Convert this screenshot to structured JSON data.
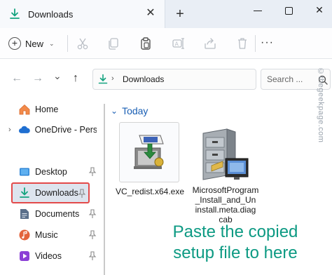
{
  "window": {
    "tab_title": "Downloads",
    "close_tab_glyph": "✕",
    "new_tab_glyph": "+",
    "minimize_label": "",
    "maximize_label": "",
    "close_glyph": "✕"
  },
  "toolbar": {
    "new_label": "New",
    "new_caret": "⌄",
    "more_glyph": "···",
    "icons": [
      "cut-icon",
      "copy-icon",
      "paste-icon",
      "rename-icon",
      "share-icon",
      "delete-icon"
    ]
  },
  "address": {
    "back_glyph": "←",
    "forward_glyph": "→",
    "dropdown_glyph": "⌄",
    "up_glyph": "↑",
    "path_chevron": "›",
    "path_label": "Downloads",
    "search_placeholder": "Search ..."
  },
  "sidebar": {
    "items": [
      {
        "label": "Home",
        "icon": "home-icon",
        "chevron": "",
        "pinned": false
      },
      {
        "label": "OneDrive - Pers",
        "icon": "cloud-icon",
        "chevron": "›",
        "pinned": false
      },
      {
        "label": "Desktop",
        "icon": "desktop-icon",
        "chevron": "",
        "pinned": true
      },
      {
        "label": "Downloads",
        "icon": "download-icon",
        "chevron": "",
        "pinned": true,
        "selected": true
      },
      {
        "label": "Documents",
        "icon": "document-icon",
        "chevron": "",
        "pinned": true
      },
      {
        "label": "Music",
        "icon": "music-icon",
        "chevron": "",
        "pinned": true
      },
      {
        "label": "Videos",
        "icon": "video-icon",
        "chevron": "",
        "pinned": true
      }
    ]
  },
  "content": {
    "group_chevron": "⌄",
    "group_label": "Today",
    "files": [
      {
        "name": "VC_redist.x64.exe",
        "icon": "installer-icon"
      },
      {
        "name_lines": [
          "MicrosoftProgram",
          "_Install_and_Un",
          "install.meta.diag",
          "cab"
        ],
        "icon": "cabinet-icon"
      }
    ]
  },
  "overlay": {
    "line1": "Paste the copied",
    "line2": "setup file to here"
  },
  "watermark": "©thegeekpage.com",
  "colors": {
    "accent": "#1a5fb4",
    "download_green": "#14a37f",
    "highlight_red": "#e34a4a",
    "overlay_teal": "#0d9a83"
  }
}
